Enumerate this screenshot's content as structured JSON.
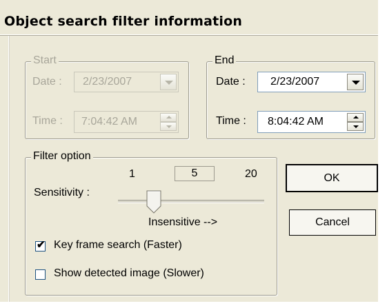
{
  "window": {
    "title": "Object search filter information"
  },
  "start": {
    "legend": "Start",
    "date_label": "Date :",
    "date_value": "2/23/2007",
    "time_label": "Time :",
    "time_value": "7:04:42 AM"
  },
  "end": {
    "legend": "End",
    "date_label": "Date :",
    "date_value": "2/23/2007",
    "time_label": "Time :",
    "time_value": "8:04:42 AM"
  },
  "filter": {
    "legend": "Filter option",
    "sensitivity_label": "Sensitivity :",
    "slider_min": "1",
    "slider_max": "20",
    "slider_value": "5",
    "slider_hint": "Insensitive -->",
    "keyframe_label": "Key frame search (Faster)",
    "keyframe_checked": true,
    "show_image_label": "Show detected image (Slower)",
    "show_image_checked": false
  },
  "buttons": {
    "ok": "OK",
    "cancel": "Cancel"
  },
  "icons": {
    "dropdown": "chevron-down-icon",
    "spin_up": "spin-up-icon",
    "spin_down": "spin-down-icon",
    "check": "checkmark-icon"
  }
}
